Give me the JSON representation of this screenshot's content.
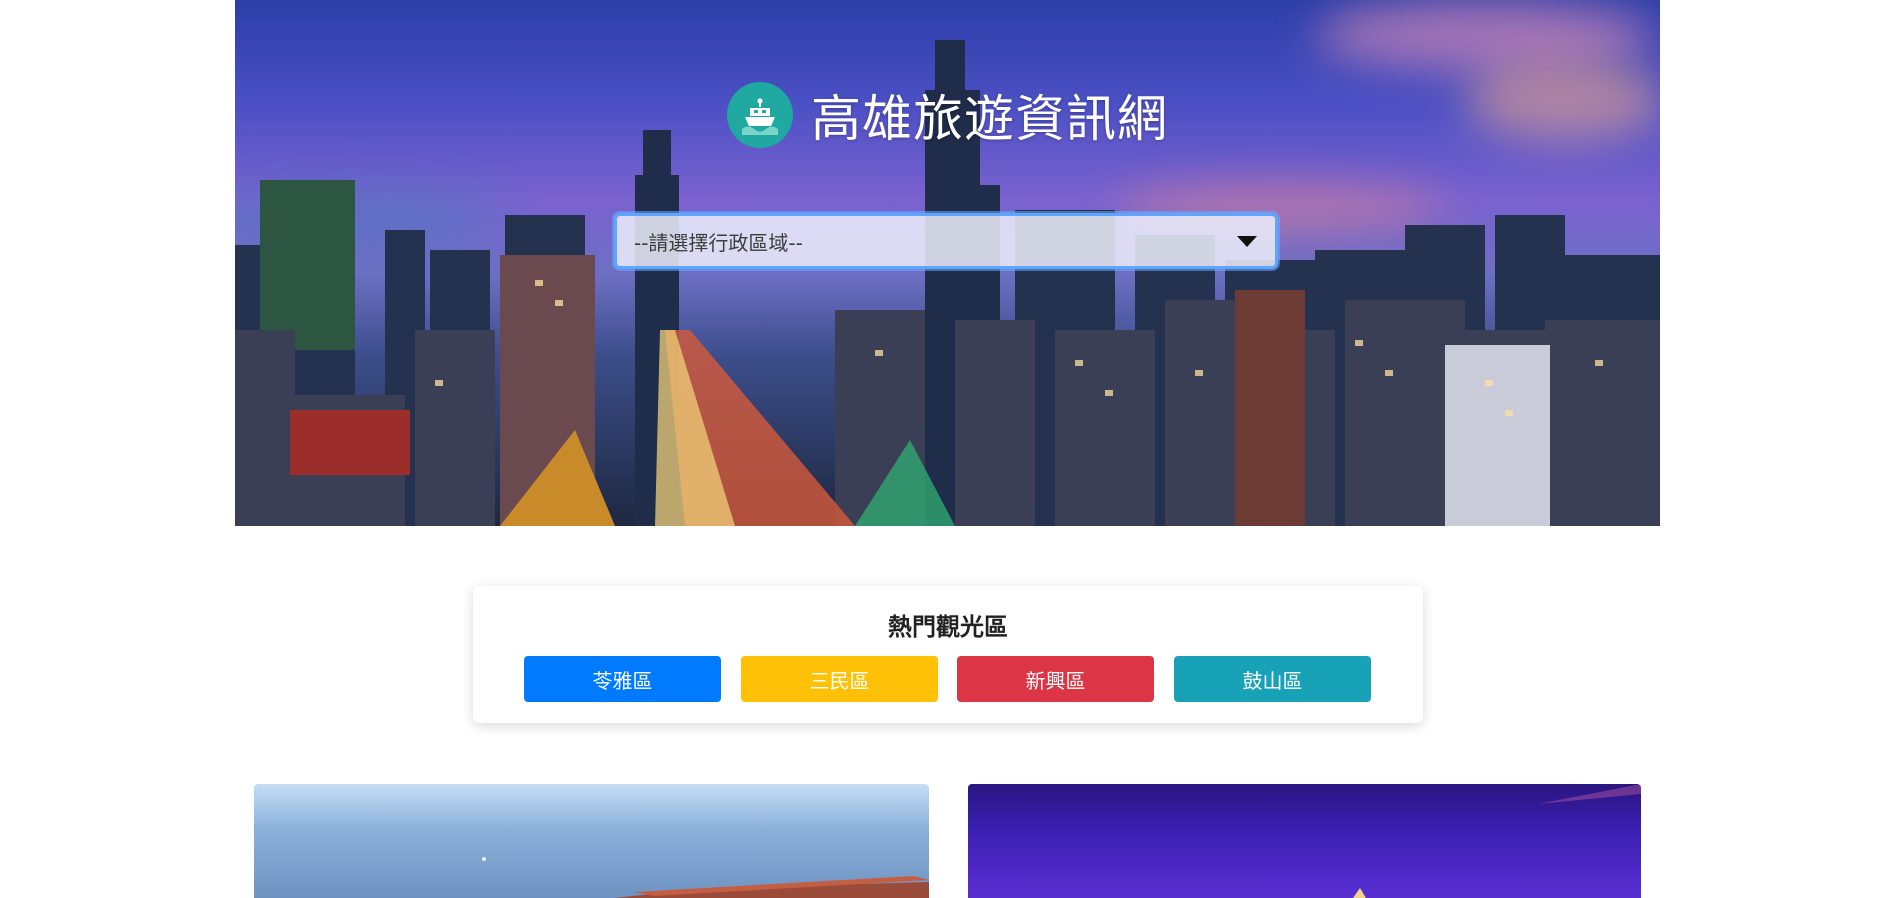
{
  "header": {
    "site_title": "高雄旅遊資訊網",
    "logo_icon": "ship-icon"
  },
  "district_select": {
    "selected": "--請選擇行政區域--",
    "icon": "caret-down-icon"
  },
  "popular": {
    "title": "熱門觀光區",
    "buttons": [
      {
        "label": "苓雅區",
        "color": "#007bff"
      },
      {
        "label": "三民區",
        "color": "#ffc107"
      },
      {
        "label": "新興區",
        "color": "#dc3545"
      },
      {
        "label": "鼓山區",
        "color": "#17a2b8"
      }
    ]
  },
  "colors": {
    "logo_bg": "#1fa9a1",
    "select_border": "#5da6ff"
  }
}
